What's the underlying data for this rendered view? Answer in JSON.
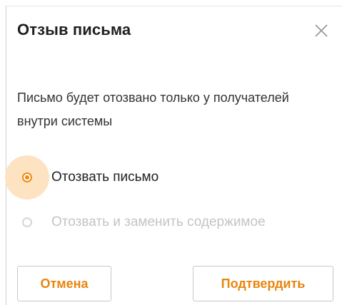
{
  "dialog": {
    "title": "Отзыв письма",
    "description": "Письмо будет отозвано только у получателей внутри системы",
    "options": [
      {
        "label": "Отозвать письмо",
        "selected": true,
        "enabled": true
      },
      {
        "label": "Отозвать и заменить содержимое",
        "selected": false,
        "enabled": false
      }
    ],
    "cancel_label": "Отмена",
    "confirm_label": "Подтвердить",
    "close_icon": "close-icon"
  },
  "colors": {
    "accent": "#f08a10",
    "accent_halo": "#fde3c1",
    "button_text": "#e8850c",
    "disabled": "#c4c4c4"
  }
}
